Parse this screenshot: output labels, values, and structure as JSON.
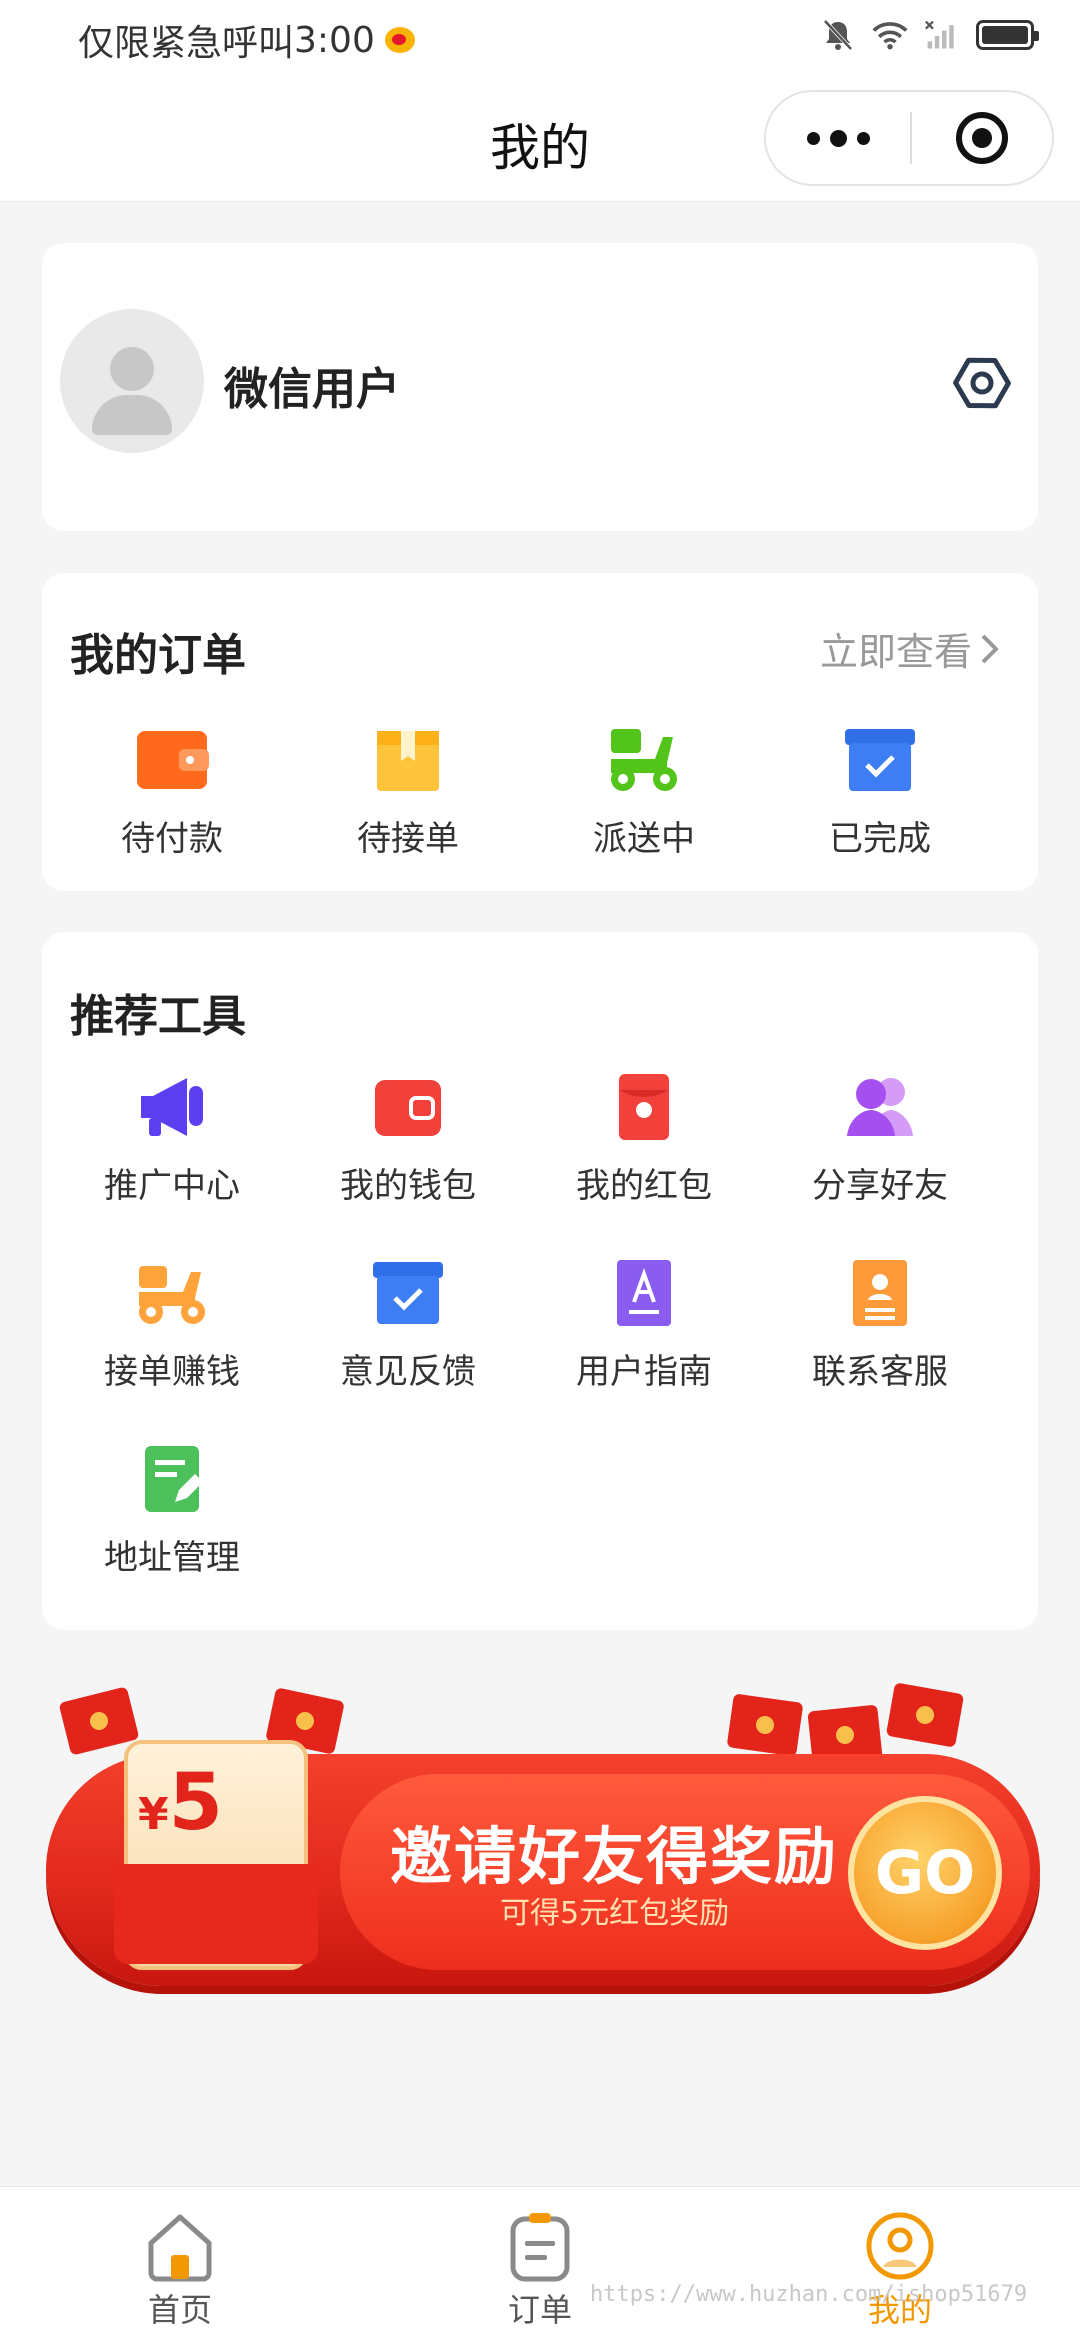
{
  "status_bar": {
    "left_text": "仅限紧急呼叫",
    "time": "3:00",
    "icons": [
      "weibo-icon",
      "mute-bell-icon",
      "wifi-icon",
      "no-signal-icon",
      "battery-icon"
    ]
  },
  "nav": {
    "title": "我的",
    "capsule": {
      "more": "more-dots-icon",
      "close": "miniprogram-close-icon"
    }
  },
  "profile": {
    "name": "微信用户",
    "avatar": "default-avatar-icon",
    "settings": "settings-hexagon-icon"
  },
  "orders": {
    "title": "我的订单",
    "view_all": "立即查看",
    "items": [
      {
        "label": "待付款",
        "icon": "wallet-icon",
        "color": "#ff6a1c"
      },
      {
        "label": "待接单",
        "icon": "box-icon",
        "color": "#ffc43b"
      },
      {
        "label": "派送中",
        "icon": "scooter-icon",
        "color": "#52c41a"
      },
      {
        "label": "已完成",
        "icon": "checked-box-icon",
        "color": "#3d7ef5"
      }
    ]
  },
  "tools": {
    "title": "推荐工具",
    "items": [
      {
        "label": "推广中心",
        "icon": "megaphone-icon",
        "color": "#5b3ff0"
      },
      {
        "label": "我的钱包",
        "icon": "wallet-icon",
        "color": "#f2403a"
      },
      {
        "label": "我的红包",
        "icon": "red-envelope-icon",
        "color": "#f2403a"
      },
      {
        "label": "分享好友",
        "icon": "users-icon",
        "color": "#b15cf0"
      },
      {
        "label": "接单赚钱",
        "icon": "scooter-icon",
        "color": "#ffa43b"
      },
      {
        "label": "意见反馈",
        "icon": "checked-box-icon",
        "color": "#3d7ef5"
      },
      {
        "label": "用户指南",
        "icon": "guide-book-icon",
        "color": "#8a5cf0"
      },
      {
        "label": "联系客服",
        "icon": "contact-book-icon",
        "color": "#ff9a3b"
      },
      {
        "label": "地址管理",
        "icon": "edit-note-icon",
        "color": "#4cc05a"
      }
    ]
  },
  "banner": {
    "amount_symbol": "¥",
    "amount": "5",
    "title": "邀请好友得奖励",
    "subtitle": "可得5元红包奖励",
    "go": "GO"
  },
  "tabbar": {
    "items": [
      {
        "label": "首页",
        "icon": "home-icon",
        "active": false
      },
      {
        "label": "订单",
        "icon": "order-list-icon",
        "active": false
      },
      {
        "label": "我的",
        "icon": "profile-icon",
        "active": true
      }
    ],
    "active_color": "#f39800"
  },
  "watermark": "https://www.huzhan.com/ishop51679"
}
